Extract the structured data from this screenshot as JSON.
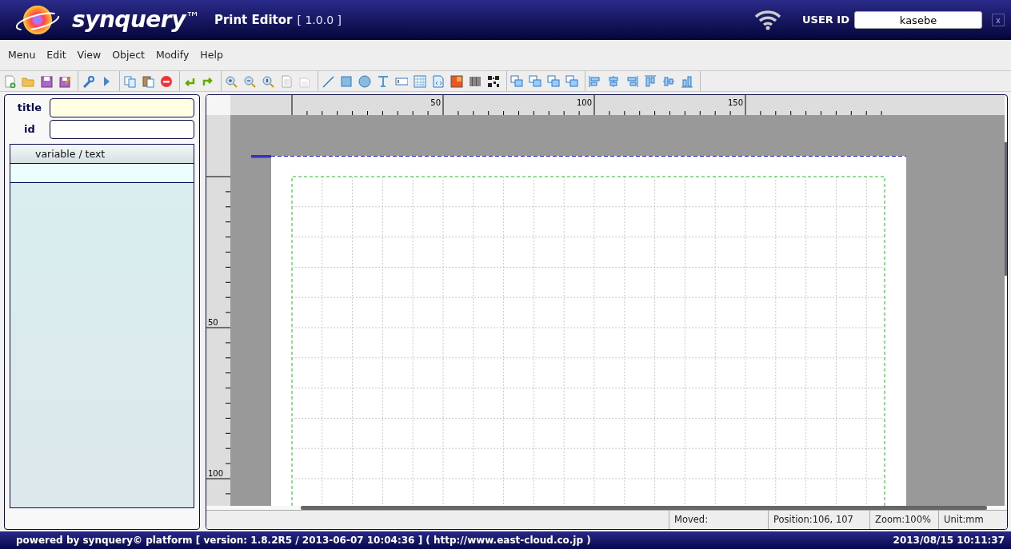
{
  "header": {
    "logo": "synquery",
    "trademark": "™",
    "app_title": "Print Editor",
    "version": "[ 1.0.0 ]",
    "user_id_label": "USER ID",
    "user_id": "kasebe",
    "close": "x"
  },
  "menu": [
    "Menu",
    "Edit",
    "View",
    "Object",
    "Modify",
    "Help"
  ],
  "form": {
    "fields": [
      {
        "label": "title",
        "highlighted": true
      },
      {
        "label": "id",
        "highlighted": false
      }
    ],
    "table": {
      "header": "variable / text",
      "rows": [
        {
          "selected": true
        }
      ]
    }
  },
  "rulers": {
    "top_labels": [
      "50",
      "100",
      "150"
    ],
    "left_labels": [
      "50",
      "100"
    ]
  },
  "status_bar": [
    "Moved:",
    "Position:106, 107",
    "Zoom:100%",
    "Unit:mm"
  ],
  "footer": {
    "powered_by": "powered by synquery© platform [ version: 1.8.2R5 / 2013-06-07 10:04:36 ] ( http://www.east-cloud.co.jp )",
    "datetime": "2013/08/15 10:11:37"
  }
}
